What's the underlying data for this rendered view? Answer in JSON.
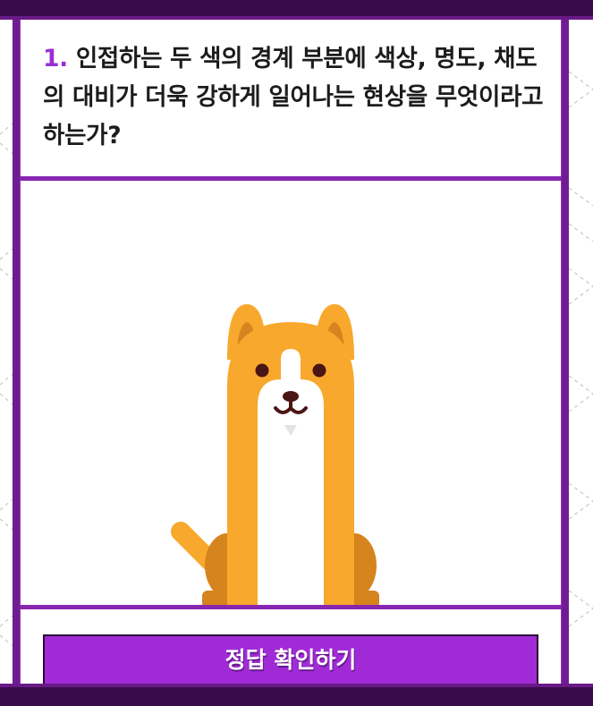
{
  "question": {
    "number": "1.",
    "text": "인접하는 두 색의 경계 부분에 색상, 명도, 채도의 대비가 더욱 강하게 일어나는 현상을 무엇이라고 하는가?"
  },
  "illustration": {
    "subject": "dog-illustration",
    "colors": {
      "fur": "#f8a82c",
      "fur_dark": "#d6841e",
      "belly": "#ffffff",
      "eyes": "#4a1515"
    }
  },
  "answer_button": {
    "label": "정답 확인하기"
  },
  "colors": {
    "accent": "#a02bd6",
    "frame": "#6f1c94",
    "bar": "#3a0b4a",
    "question_number": "#9a2fd6"
  }
}
